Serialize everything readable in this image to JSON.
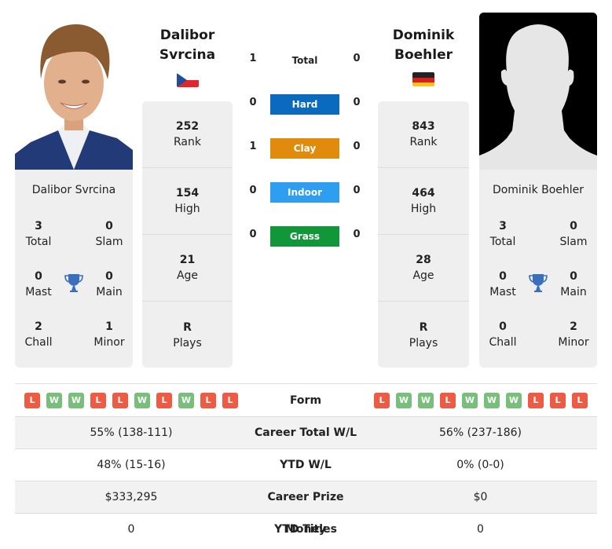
{
  "left_player": {
    "name_line1": "Dalibor",
    "name_line2": "Svrcina",
    "full_name": "Dalibor Svrcina",
    "flag": "czech-republic-flag",
    "rank": "252",
    "rank_label": "Rank",
    "high": "154",
    "high_label": "High",
    "age": "21",
    "age_label": "Age",
    "plays": "R",
    "plays_label": "Plays",
    "titles": {
      "total": "3",
      "total_label": "Total",
      "slam": "0",
      "slam_label": "Slam",
      "mast": "0",
      "mast_label": "Mast",
      "main": "0",
      "main_label": "Main",
      "chall": "2",
      "chall_label": "Chall",
      "minor": "1",
      "minor_label": "Minor"
    },
    "form": [
      "L",
      "W",
      "W",
      "L",
      "L",
      "W",
      "L",
      "W",
      "L",
      "L"
    ]
  },
  "right_player": {
    "name_line1": "Dominik",
    "name_line2": "Boehler",
    "full_name": "Dominik Boehler",
    "flag": "germany-flag",
    "rank": "843",
    "rank_label": "Rank",
    "high": "464",
    "high_label": "High",
    "age": "28",
    "age_label": "Age",
    "plays": "R",
    "plays_label": "Plays",
    "titles": {
      "total": "3",
      "total_label": "Total",
      "slam": "0",
      "slam_label": "Slam",
      "mast": "0",
      "mast_label": "Mast",
      "main": "0",
      "main_label": "Main",
      "chall": "0",
      "chall_label": "Chall",
      "minor": "2",
      "minor_label": "Minor"
    },
    "form": [
      "L",
      "W",
      "W",
      "L",
      "W",
      "W",
      "W",
      "L",
      "L",
      "L"
    ]
  },
  "h2h": [
    {
      "label": "Total",
      "left": "1",
      "right": "0",
      "color": null
    },
    {
      "label": "Hard",
      "left": "0",
      "right": "0",
      "color": "#0a6abf"
    },
    {
      "label": "Clay",
      "left": "1",
      "right": "0",
      "color": "#e08b0c"
    },
    {
      "label": "Indoor",
      "left": "0",
      "right": "0",
      "color": "#2e9ef0"
    },
    {
      "label": "Grass",
      "left": "0",
      "right": "0",
      "color": "#12963a"
    }
  ],
  "form_label": "Form",
  "comparison": [
    {
      "label": "Career Total W/L",
      "left": "55% (138-111)",
      "right": "56% (237-186)"
    },
    {
      "label": "YTD W/L",
      "left": "48% (15-16)",
      "right": "0% (0-0)"
    },
    {
      "label": "Career Prize Money",
      "left": "$333,295",
      "right": "$0"
    },
    {
      "label": "YTD Titles",
      "left": "0",
      "right": "0"
    }
  ]
}
